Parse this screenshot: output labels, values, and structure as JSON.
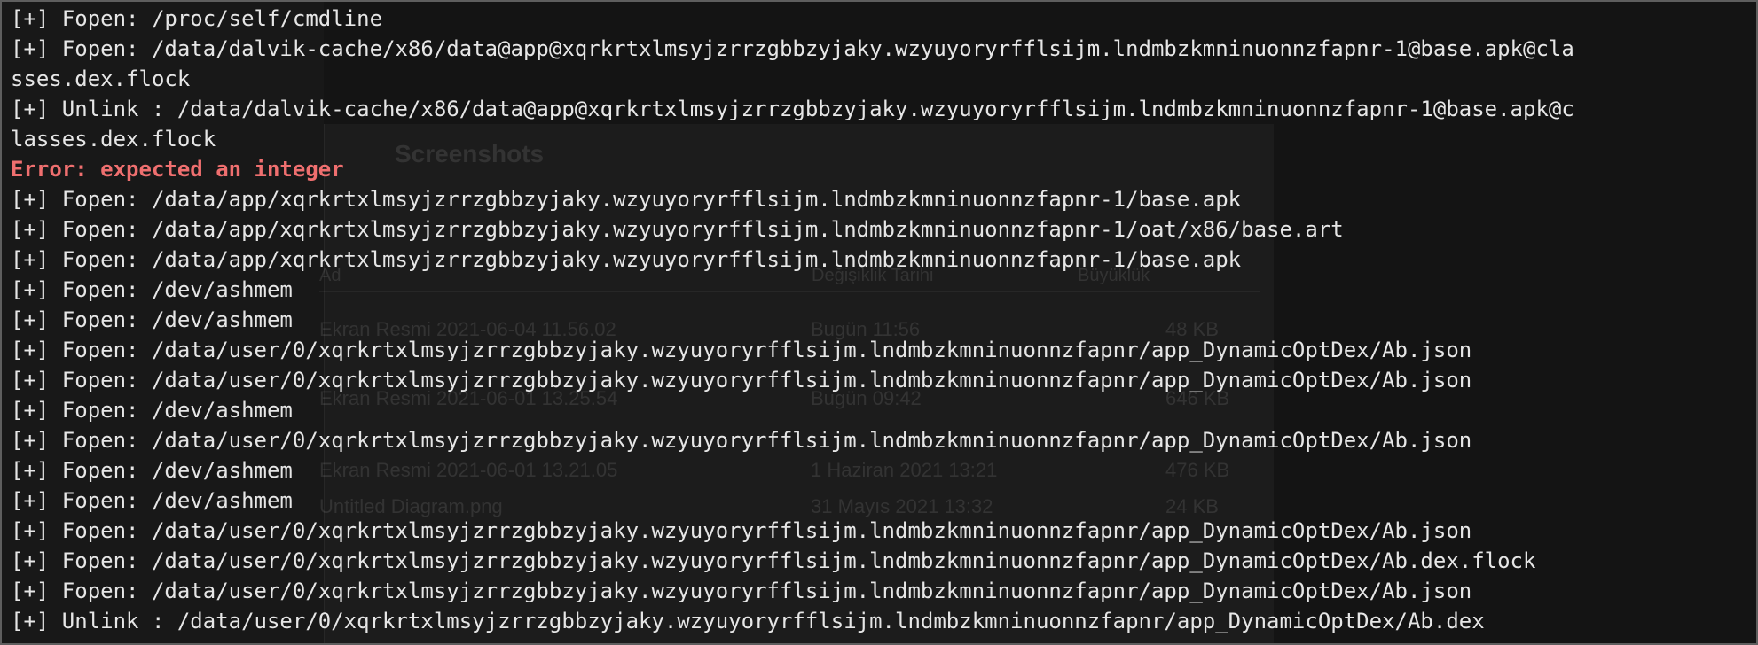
{
  "terminal": {
    "lines": [
      {
        "text": "[+] Fopen: /proc/self/cmdline",
        "kind": "normal"
      },
      {
        "text": "[+] Fopen: /data/dalvik-cache/x86/data@app@xqrkrtxlmsyjzrrzgbbzyjaky.wzyuyoryrfflsijm.lndmbzkmninuonnzfapnr-1@base.apk@cla",
        "kind": "normal"
      },
      {
        "text": "sses.dex.flock",
        "kind": "normal"
      },
      {
        "text": "[+] Unlink : /data/dalvik-cache/x86/data@app@xqrkrtxlmsyjzrrzgbbzyjaky.wzyuyoryrfflsijm.lndmbzkmninuonnzfapnr-1@base.apk@c",
        "kind": "normal"
      },
      {
        "text": "lasses.dex.flock",
        "kind": "normal"
      },
      {
        "text": "Error: expected an integer",
        "kind": "error"
      },
      {
        "text": "[+] Fopen: /data/app/xqrkrtxlmsyjzrrzgbbzyjaky.wzyuyoryrfflsijm.lndmbzkmninuonnzfapnr-1/base.apk",
        "kind": "normal"
      },
      {
        "text": "[+] Fopen: /data/app/xqrkrtxlmsyjzrrzgbbzyjaky.wzyuyoryrfflsijm.lndmbzkmninuonnzfapnr-1/oat/x86/base.art",
        "kind": "normal"
      },
      {
        "text": "[+] Fopen: /data/app/xqrkrtxlmsyjzrrzgbbzyjaky.wzyuyoryrfflsijm.lndmbzkmninuonnzfapnr-1/base.apk",
        "kind": "normal"
      },
      {
        "text": "[+] Fopen: /dev/ashmem",
        "kind": "normal"
      },
      {
        "text": "[+] Fopen: /dev/ashmem",
        "kind": "normal"
      },
      {
        "text": "[+] Fopen: /data/user/0/xqrkrtxlmsyjzrrzgbbzyjaky.wzyuyoryrfflsijm.lndmbzkmninuonnzfapnr/app_DynamicOptDex/Ab.json",
        "kind": "normal"
      },
      {
        "text": "[+] Fopen: /data/user/0/xqrkrtxlmsyjzrrzgbbzyjaky.wzyuyoryrfflsijm.lndmbzkmninuonnzfapnr/app_DynamicOptDex/Ab.json",
        "kind": "normal"
      },
      {
        "text": "[+] Fopen: /dev/ashmem",
        "kind": "normal"
      },
      {
        "text": "[+] Fopen: /data/user/0/xqrkrtxlmsyjzrrzgbbzyjaky.wzyuyoryrfflsijm.lndmbzkmninuonnzfapnr/app_DynamicOptDex/Ab.json",
        "kind": "normal"
      },
      {
        "text": "[+] Fopen: /dev/ashmem",
        "kind": "normal"
      },
      {
        "text": "[+] Fopen: /dev/ashmem",
        "kind": "normal"
      },
      {
        "text": "[+] Fopen: /data/user/0/xqrkrtxlmsyjzrrzgbbzyjaky.wzyuyoryrfflsijm.lndmbzkmninuonnzfapnr/app_DynamicOptDex/Ab.json",
        "kind": "normal"
      },
      {
        "text": "[+] Fopen: /data/user/0/xqrkrtxlmsyjzrrzgbbzyjaky.wzyuyoryrfflsijm.lndmbzkmninuonnzfapnr/app_DynamicOptDex/Ab.dex.flock",
        "kind": "normal"
      },
      {
        "text": "[+] Fopen: /data/user/0/xqrkrtxlmsyjzrrzgbbzyjaky.wzyuyoryrfflsijm.lndmbzkmninuonnzfapnr/app_DynamicOptDex/Ab.json",
        "kind": "normal"
      },
      {
        "text": "[+] Unlink : /data/user/0/xqrkrtxlmsyjzrrzgbbzyjaky.wzyuyoryrfflsijm.lndmbzkmninuonnzfapnr/app_DynamicOptDex/Ab.dex",
        "kind": "normal"
      }
    ]
  },
  "background_window": {
    "title": "Screenshots",
    "columns": [
      "Ad",
      "Değişiklik Tarihi",
      "Büyüklük"
    ],
    "rows": [
      {
        "name": "Ekran Resmi 2021-06-04 11.56.02",
        "date": "Bugün 11:56",
        "size": "48 KB"
      },
      {
        "name": "Ekran Resmi 2021-06-01 13.25.54",
        "date": "Bugün 09:42",
        "size": "646 KB"
      },
      {
        "name": "Ekran Resmi 2021-06-01 13.21.05",
        "date": "1 Haziran 2021 13:21",
        "size": "476 KB"
      },
      {
        "name": "Untitled Diagram.png",
        "date": "31 Mayıs 2021 13:32",
        "size": "24 KB"
      }
    ]
  },
  "colors": {
    "text": "#e6e6e6",
    "error": "#ef6f6f",
    "background": "#141414"
  }
}
